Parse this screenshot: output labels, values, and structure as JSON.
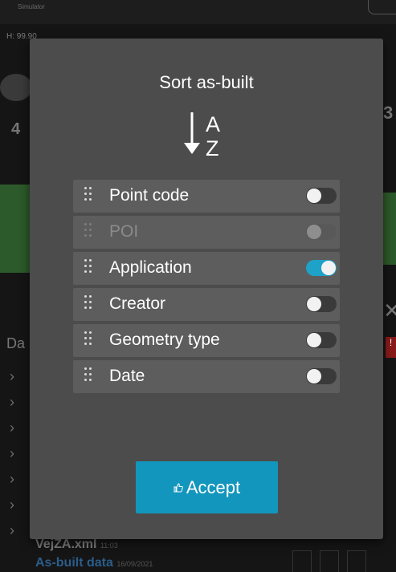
{
  "background": {
    "app_title": "Simulator",
    "h_label": "H: 99.90",
    "left_number": "4",
    "right_number": "3",
    "section_label": "Da",
    "file_row": "VejZA.xml",
    "file_row_meta": "11:03",
    "folder_row": "As-built data",
    "folder_row_meta": "16/09/2021"
  },
  "dialog": {
    "title": "Sort as-built",
    "sort_icon": "sort-a-z-descending-icon",
    "items": [
      {
        "label": "Point code",
        "enabled": true,
        "on": false
      },
      {
        "label": "POI",
        "enabled": false,
        "on": false
      },
      {
        "label": "Application",
        "enabled": true,
        "on": true
      },
      {
        "label": "Creator",
        "enabled": true,
        "on": false
      },
      {
        "label": "Geometry type",
        "enabled": true,
        "on": false
      },
      {
        "label": "Date",
        "enabled": true,
        "on": false
      }
    ],
    "accept_label": "Accept",
    "accept_icon": "thumbs-up-icon"
  },
  "colors": {
    "accent": "#1396bd",
    "toggle_on": "#1ea2c7",
    "dialog_bg": "#4c4c4c",
    "row_bg": "#5d5d5d"
  }
}
